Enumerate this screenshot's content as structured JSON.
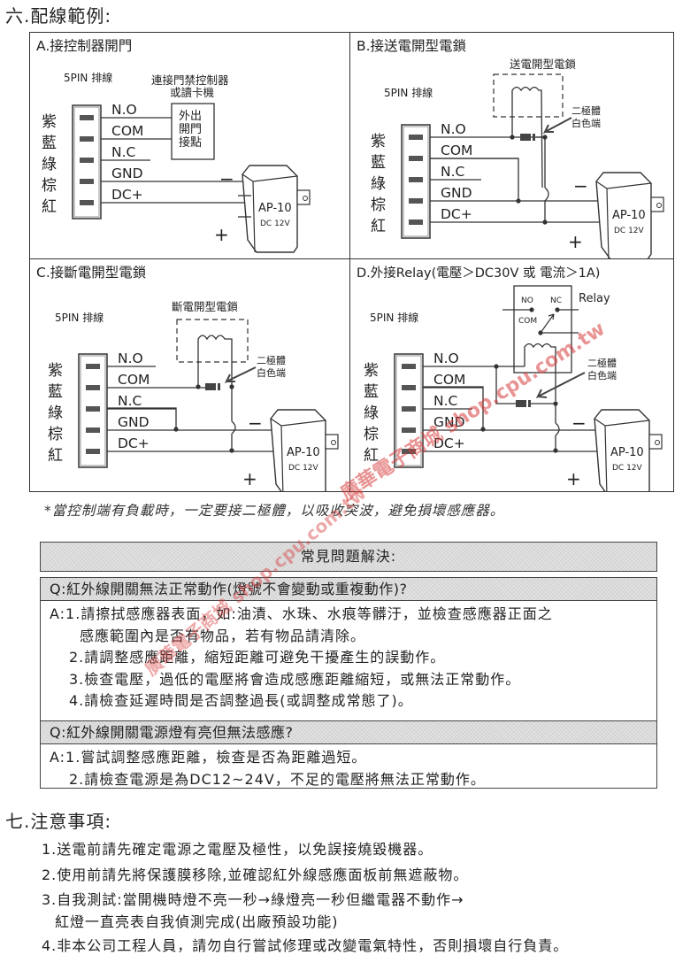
{
  "section6": {
    "title": "六.配線範例:"
  },
  "diagrams": [
    {
      "id": "A",
      "title": "A.接控制器開門",
      "connector_label": "5PIN 排線",
      "wire_colors": [
        "紫",
        "藍",
        "綠",
        "棕",
        "紅"
      ],
      "pins": [
        "N.O",
        "COM",
        "N.C",
        "GND",
        "DC+"
      ],
      "external_device_label_line1": "連接門禁控制器",
      "external_device_label_line2": "或讀卡機",
      "contact_box_lines": [
        "外出",
        "開門",
        "接點"
      ],
      "adapter": {
        "model": "AP-10",
        "rating": "DC 12V",
        "minus": "−",
        "plus": "+"
      }
    },
    {
      "id": "B",
      "title": "B.接送電開型電鎖",
      "connector_label": "5PIN 排線",
      "wire_colors": [
        "紫",
        "藍",
        "綠",
        "棕",
        "紅"
      ],
      "pins": [
        "N.O",
        "COM",
        "N.C",
        "GND",
        "DC+"
      ],
      "lock_label": "送電開型電鎖",
      "diode_label_line1": "二極體",
      "diode_label_line2": "白色端",
      "adapter": {
        "model": "AP-10",
        "rating": "DC 12V",
        "minus": "−",
        "plus": "+"
      }
    },
    {
      "id": "C",
      "title": "C.接斷電開型電鎖",
      "connector_label": "5PIN 排線",
      "wire_colors": [
        "紫",
        "藍",
        "綠",
        "棕",
        "紅"
      ],
      "pins": [
        "N.O",
        "COM",
        "N.C",
        "GND",
        "DC+"
      ],
      "lock_label": "斷電開型電鎖",
      "diode_label_line1": "二極體",
      "diode_label_line2": "白色端",
      "adapter": {
        "model": "AP-10",
        "rating": "DC 12V",
        "minus": "−",
        "plus": "+"
      }
    },
    {
      "id": "D",
      "title": "D.外接Relay(電壓＞DC30V 或 電流＞1A)",
      "connector_label": "5PIN 排線",
      "wire_colors": [
        "紫",
        "藍",
        "綠",
        "棕",
        "紅"
      ],
      "pins": [
        "N.O",
        "COM",
        "N.C",
        "GND",
        "DC+"
      ],
      "relay_label": "Relay",
      "relay_terminals": [
        "NO",
        "NC",
        "COM"
      ],
      "diode_label_line1": "二極體",
      "diode_label_line2": "白色端",
      "adapter": {
        "model": "AP-10",
        "rating": "DC 12V",
        "minus": "−",
        "plus": "+"
      }
    }
  ],
  "diode_note": "*當控制端有負載時，一定要接二極體，以吸收突波，避免損壞感應器。",
  "faq": {
    "title": "常見問題解決:",
    "items": [
      {
        "question": "Q:紅外線開關無法正常動作(燈號不會變動或重複動作)?",
        "answers": [
          "A:1.請擦拭感應器表面，如:油漬、水珠、水痕等髒汙，並檢查感應器正面之",
          "感應範圍內是否有物品，若有物品請清除。",
          "2.請調整感應距離，縮短距離可避免干擾產生的誤動作。",
          "3.檢查電壓，過低的電壓將會造成感應距離縮短，或無法正常動作。",
          "4.請檢查延遲時間是否調整過長(或調整成常態了)。"
        ]
      },
      {
        "question": "Q:紅外線開關電源燈有亮但無法感應?",
        "answers": [
          "A:1.嘗試調整感應距離，檢查是否為距離過短。",
          "2.請檢查電源是為DC12~24V，不足的電壓將無法正常動作。"
        ]
      }
    ]
  },
  "section7": {
    "title": "七.注意事項:",
    "items": [
      "1.送電前請先確定電源之電壓及極性，以免誤接燒毀機器。",
      "2.使用前請先將保護膜移除,並確認紅外線感應面板前無遮蔽物。",
      "3.自我測試:當開機時燈不亮一秒→綠燈亮一秒但繼電器不動作→",
      "紅燈一直亮表自我偵測完成(出廠預設功能)",
      "4.非本公司工程人員，請勿自行嘗試修理或改變電氣特性，否則損壞自行負責。"
    ]
  },
  "watermark": {
    "text": "廣華電子商城 shop.cpu.com.tw",
    "color": "#d73c3c"
  }
}
